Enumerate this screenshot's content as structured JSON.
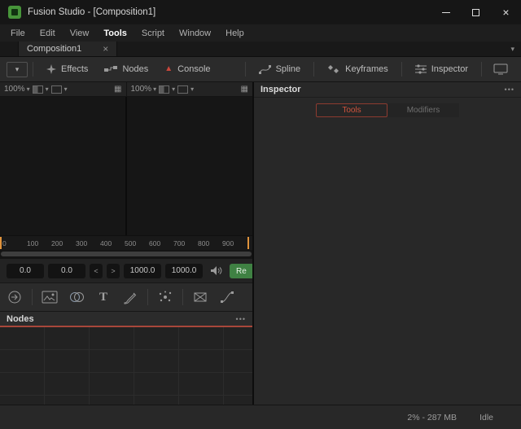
{
  "window": {
    "title": "Fusion Studio - [Composition1]",
    "close_glyph": "×"
  },
  "menu": {
    "items": [
      "File",
      "Edit",
      "View",
      "Tools",
      "Script",
      "Window",
      "Help"
    ],
    "active_item": "Tools"
  },
  "tabbar": {
    "tab_label": "Composition1",
    "close_glyph": "×"
  },
  "toolbar": {
    "effects": "Effects",
    "nodes": "Nodes",
    "console": "Console",
    "spline": "Spline",
    "keyframes": "Keyframes",
    "inspector": "Inspector"
  },
  "viewers": {
    "left_zoom": "100%",
    "right_zoom": "100%"
  },
  "ruler": {
    "ticks": [
      "0",
      "100",
      "200",
      "300",
      "400",
      "500",
      "600",
      "700",
      "800",
      "900"
    ]
  },
  "transport": {
    "fields": [
      "0.0",
      "0.0",
      "1000.0",
      "1000.0"
    ],
    "step_back": "<",
    "step_forward": ">",
    "render_label": "Re"
  },
  "tool_icons": [
    "io-node",
    "media-in",
    "merge",
    "text",
    "paint",
    "particles",
    "mask",
    "color-curves"
  ],
  "nodes_panel": {
    "title": "Nodes"
  },
  "inspector": {
    "title": "Inspector",
    "tabs": {
      "tools": "Tools",
      "modifiers": "Modifiers"
    }
  },
  "statusbar": {
    "memory": "2% - 287 MB",
    "state": "Idle"
  },
  "icons": {
    "caret": "▾",
    "menu_dots": "•••",
    "warning": "▲",
    "grid": "▦"
  },
  "colors": {
    "accent_red": "#a8473a",
    "warning_red": "#c9473c",
    "render_green": "#3f8143",
    "range_orange": "#e0933c"
  }
}
